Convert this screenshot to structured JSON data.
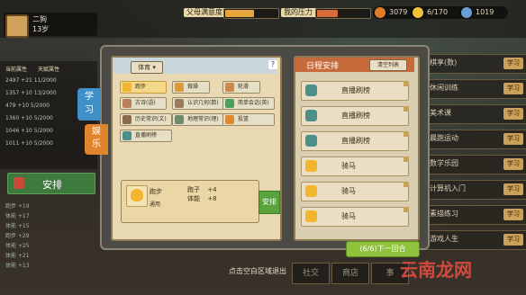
{
  "player": {
    "name": "二狗",
    "age": "13岁"
  },
  "meters": {
    "parent_label": "父母满意度",
    "parent_level": 0.55,
    "stress_label": "我的压力",
    "stress_level": 0.4
  },
  "resources": [
    {
      "name": "coin-icon",
      "value": "3079",
      "color": "#e07b2a"
    },
    {
      "name": "energy-icon",
      "value": "6/170",
      "color": "#f0c23a"
    },
    {
      "name": "gem-icon",
      "value": "1019",
      "color": "#6a9fd6"
    }
  ],
  "stats_header": [
    "当前属性",
    "天赋属性"
  ],
  "stats_rows": [
    "2497  +21  11/2000",
    "1357  +10  13/2000",
    "479  +10  5/2000",
    "1360  +10  5/2000",
    "1046  +10  5/2000",
    "1011  +10  5/2000"
  ],
  "left_arrange": "安排",
  "log_lines": [
    "跑步 +19",
    "体能 +17",
    "体能 +15",
    "跑步 +29",
    "体能 +25",
    "体能 +21",
    "体能 +13"
  ],
  "right_list": [
    {
      "label": "棋享(数)",
      "badge": "学习"
    },
    {
      "label": "休闲训练",
      "badge": "学习"
    },
    {
      "label": "美术课",
      "badge": "学习"
    },
    {
      "label": "晨跑运动",
      "badge": "学习"
    },
    {
      "label": "数学乐园",
      "badge": "学习"
    },
    {
      "label": "计算机入门",
      "badge": "学习"
    },
    {
      "label": "素描练习",
      "badge": "学习"
    },
    {
      "label": "游戏人生",
      "badge": "学习"
    }
  ],
  "tabs": {
    "learn": "学\n习",
    "fun": "娱\n乐"
  },
  "filter": "体育",
  "help": "?",
  "activities": [
    {
      "label": "跑步",
      "color": "#f1b52f",
      "selected": true
    },
    {
      "label": "做操",
      "color": "#d99a3a",
      "selected": false
    },
    {
      "label": "轮滑",
      "color": "#c98a4a",
      "selected": false
    },
    {
      "label": "古诗(语)",
      "color": "#b8815a",
      "selected": false
    },
    {
      "label": "认识几何(数)",
      "color": "#9b7b5a",
      "selected": false
    },
    {
      "label": "简单会话(英)",
      "color": "#4f9d5a",
      "selected": false
    },
    {
      "label": "历史常识(文)",
      "color": "#8a6a4a",
      "selected": false
    },
    {
      "label": "地理常识(理)",
      "color": "#6e8a6a",
      "selected": false
    },
    {
      "label": "投篮",
      "color": "#e08a2f",
      "selected": false
    },
    {
      "label": "直播刷榜",
      "color": "#4f8f8a",
      "selected": false
    }
  ],
  "detail": {
    "name": "跑步",
    "subtitle": "通用",
    "effect1_label": "跑子",
    "effect1_value": "+4",
    "effect2_label": "体能",
    "effect2_value": "+8"
  },
  "arrange_btn": "安排",
  "schedule": {
    "title": "日程安排",
    "clear": "清空列表",
    "slots": [
      {
        "label": "直播刷榜",
        "icon": "play-icon",
        "color": "#4f8f8a"
      },
      {
        "label": "直播刷榜",
        "icon": "play-icon",
        "color": "#4f8f8a"
      },
      {
        "label": "直播刷榜",
        "icon": "play-icon",
        "color": "#4f8f8a"
      },
      {
        "label": "骑马",
        "icon": "smiley-icon",
        "color": "#f1b52f"
      },
      {
        "label": "骑马",
        "icon": "smiley-icon",
        "color": "#f1b52f"
      },
      {
        "label": "骑马",
        "icon": "smiley-icon",
        "color": "#f1b52f"
      }
    ]
  },
  "next_round": "(6/6)下一回合",
  "hint": "点击空白区域退出",
  "bottom_tabs": [
    "社交",
    "商店",
    "事"
  ],
  "watermark": "云南龙网"
}
